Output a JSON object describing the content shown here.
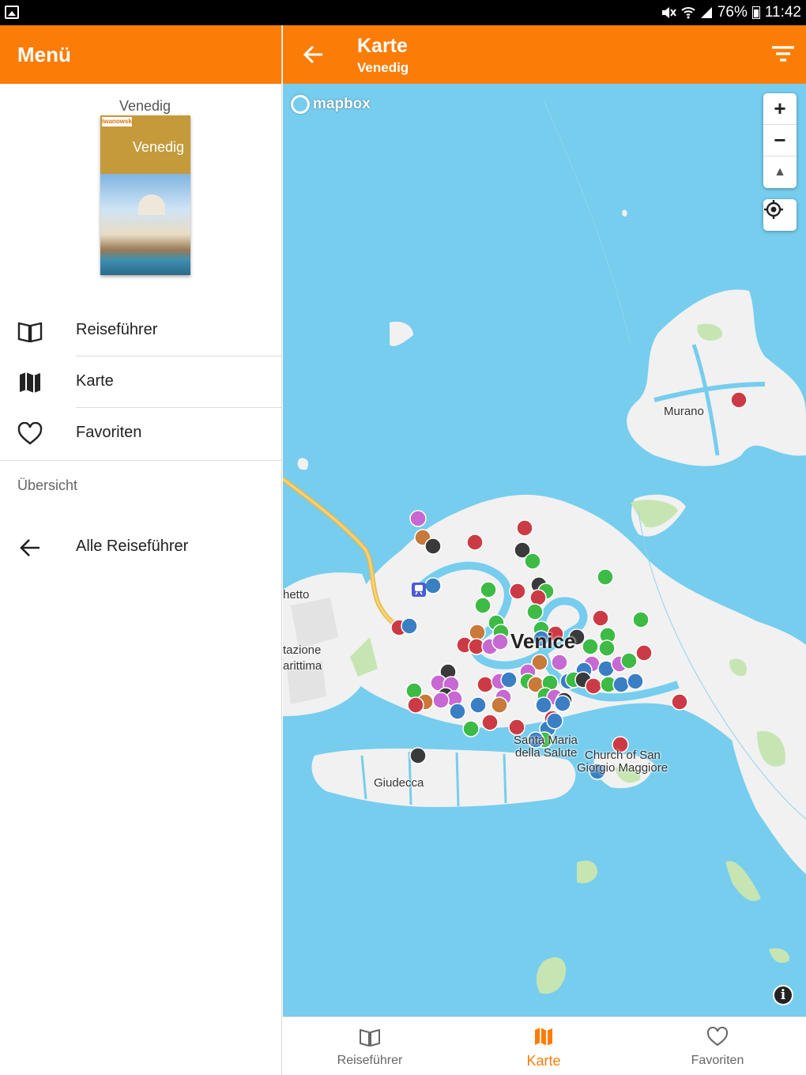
{
  "status_bar": {
    "battery": "76%",
    "time": "11:42",
    "icons": [
      "gallery-icon",
      "mute-icon",
      "wifi-icon",
      "signal-icon",
      "battery-icon"
    ]
  },
  "drawer": {
    "title": "Menü",
    "guide": {
      "title": "Venedig",
      "cover_brand": "iwanowski",
      "cover_title": "Venedig"
    },
    "items": [
      {
        "label": "Reiseführer",
        "icon": "book-icon"
      },
      {
        "label": "Karte",
        "icon": "map-icon"
      },
      {
        "label": "Favoriten",
        "icon": "heart-icon"
      }
    ],
    "section_label": "Übersicht",
    "all_guides_label": "Alle Reiseführer"
  },
  "appbar": {
    "title": "Karte",
    "subtitle": "Venedig"
  },
  "map": {
    "attribution_logo": "mapbox",
    "labels": {
      "murano": "Murano",
      "venice": "Venice",
      "ghetto": "hetto",
      "stazione_1": "tazione",
      "stazione_2": "arittima",
      "salute_1": "Santa Maria",
      "salute_2": "della Salute",
      "san_giorgio_1": "Church of San",
      "san_giorgio_2": "Giorgio Maggiore",
      "giudecca": "Giudecca"
    },
    "controls": {
      "zoom_in": "+",
      "zoom_out": "−",
      "compass": "▲",
      "info": "i"
    },
    "marker_colors": {
      "red": "#cc3b45",
      "green": "#3dbb45",
      "blue": "#3a7fc4",
      "purple": "#c868d2",
      "brown": "#c77a3a",
      "dark": "#3a3a3a"
    },
    "accent": "#fb7d08",
    "water": "#76cdee",
    "land": "#f1f1f1",
    "park": "#c6e5b3"
  },
  "bottom_nav": {
    "items": [
      {
        "label": "Reiseführer",
        "icon": "book-icon",
        "active": false
      },
      {
        "label": "Karte",
        "icon": "map-icon",
        "active": true
      },
      {
        "label": "Favoriten",
        "icon": "heart-icon",
        "active": false
      }
    ]
  }
}
